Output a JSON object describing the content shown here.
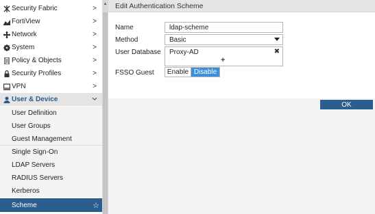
{
  "sidebar": {
    "items": [
      {
        "label": "Security Fabric",
        "icon": "security-fabric-icon",
        "chevron": ">"
      },
      {
        "label": "FortiView",
        "icon": "fortiview-icon",
        "chevron": ">"
      },
      {
        "label": "Network",
        "icon": "network-icon",
        "chevron": ">"
      },
      {
        "label": "System",
        "icon": "gear-icon",
        "chevron": ">"
      },
      {
        "label": "Policy & Objects",
        "icon": "policy-icon",
        "chevron": ">"
      },
      {
        "label": "Security Profiles",
        "icon": "lock-icon",
        "chevron": ">"
      },
      {
        "label": "VPN",
        "icon": "vpn-icon",
        "chevron": ">"
      },
      {
        "label": "User & Device",
        "icon": "user-icon",
        "chevron": "v"
      }
    ],
    "sub_items": [
      {
        "label": "User Definition"
      },
      {
        "label": "User Groups"
      },
      {
        "label": "Guest Management"
      },
      {
        "label": "Single Sign-On"
      },
      {
        "label": "LDAP Servers"
      },
      {
        "label": "RADIUS Servers"
      },
      {
        "label": "Kerberos"
      },
      {
        "label": "Scheme",
        "star": "☆"
      }
    ]
  },
  "header": {
    "title": "Edit Authentication Scheme"
  },
  "form": {
    "name_label": "Name",
    "name_value": "ldap-scheme",
    "method_label": "Method",
    "method_value": "Basic",
    "user_db_label": "User Database",
    "user_db_value": "Proxy-AD",
    "user_db_remove": "✖",
    "user_db_add": "+",
    "fsso_label": "FSSO Guest",
    "fsso_options": [
      "Enable",
      "Disable"
    ],
    "fsso_selected": "Disable"
  },
  "footer": {
    "ok_label": "OK"
  },
  "colors": {
    "accent": "#2b5d8d",
    "toggle_on": "#3c8fd9"
  }
}
